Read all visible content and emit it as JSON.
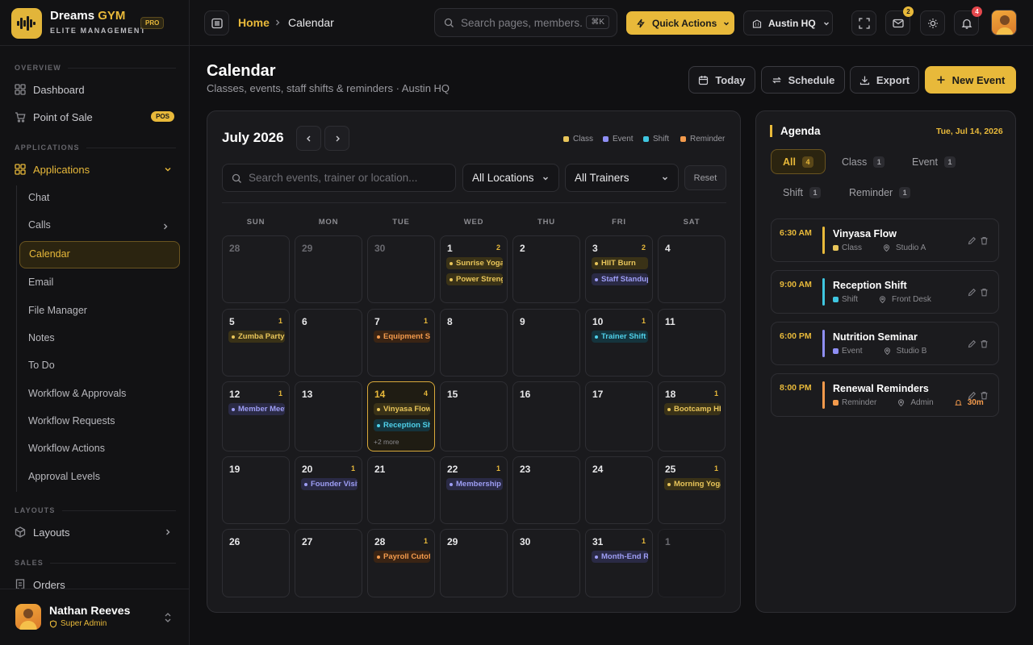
{
  "brand": {
    "name_main": "Dreams",
    "name_accent": "GYM",
    "subtitle": "ELITE MANAGEMENT",
    "badge": "PRO"
  },
  "sidebar": {
    "sections": {
      "overview": "OVERVIEW",
      "applications": "APPLICATIONS",
      "layouts": "LAYOUTS",
      "sales": "SALES"
    },
    "items": [
      {
        "label": "Dashboard",
        "icon": "dashboard-icon"
      },
      {
        "label": "Point of Sale",
        "icon": "cart-icon",
        "badge": "POS"
      },
      {
        "label": "Applications",
        "icon": "apps-grid-icon"
      },
      {
        "label": "Layouts",
        "icon": "cube-icon"
      },
      {
        "label": "Orders",
        "icon": "receipt-icon"
      }
    ],
    "subitems": [
      "Chat",
      "Calls",
      "Calendar",
      "Email",
      "File Manager",
      "Notes",
      "To Do",
      "Workflow & Approvals",
      "Workflow Requests",
      "Workflow Actions",
      "Approval Levels"
    ],
    "user": {
      "name": "Nathan Reeves",
      "role": "Super Admin"
    }
  },
  "topbar": {
    "breadcrumb": {
      "home": "Home",
      "current": "Calendar"
    },
    "search": {
      "placeholder": "Search pages, members...",
      "shortcut": "⌘K"
    },
    "quick_actions": "Quick Actions",
    "location": "Austin HQ",
    "mail_count": "2",
    "notif_count": "4"
  },
  "page": {
    "title": "Calendar",
    "subtitle": "Classes, events, staff shifts & reminders · Austin HQ",
    "buttons": {
      "today": "Today",
      "schedule": "Schedule",
      "export": "Export",
      "new_event": "New Event"
    }
  },
  "calendar": {
    "month": "July 2026",
    "legend": [
      {
        "label": "Class",
        "color": "#e8c55a"
      },
      {
        "label": "Event",
        "color": "#8f8ff5"
      },
      {
        "label": "Shift",
        "color": "#3fc6e0"
      },
      {
        "label": "Reminder",
        "color": "#f39a4c"
      }
    ],
    "filters": {
      "search_placeholder": "Search events, trainer or location...",
      "location": "All Locations",
      "trainer": "All Trainers",
      "reset": "Reset"
    },
    "weekdays": [
      "SUN",
      "MON",
      "TUE",
      "WED",
      "THU",
      "FRI",
      "SAT"
    ],
    "days": [
      {
        "d": "28",
        "muted": true
      },
      {
        "d": "29",
        "muted": true
      },
      {
        "d": "30",
        "muted": true
      },
      {
        "d": "1",
        "count": "2",
        "events": [
          {
            "t": "Sunrise Yoga",
            "k": "class"
          },
          {
            "t": "Power Strength",
            "k": "class"
          }
        ]
      },
      {
        "d": "2"
      },
      {
        "d": "3",
        "count": "2",
        "events": [
          {
            "t": "HIIT Burn",
            "k": "class"
          },
          {
            "t": "Staff Standup",
            "k": "event"
          }
        ]
      },
      {
        "d": "4"
      },
      {
        "d": "5",
        "count": "1",
        "events": [
          {
            "t": "Zumba Party",
            "k": "class"
          }
        ]
      },
      {
        "d": "6"
      },
      {
        "d": "7",
        "count": "1",
        "events": [
          {
            "t": "Equipment Service",
            "k": "reminder"
          }
        ]
      },
      {
        "d": "8"
      },
      {
        "d": "9"
      },
      {
        "d": "10",
        "count": "1",
        "events": [
          {
            "t": "Trainer Shift A",
            "k": "shift"
          }
        ]
      },
      {
        "d": "11"
      },
      {
        "d": "12",
        "count": "1",
        "events": [
          {
            "t": "Member Meetup",
            "k": "event"
          }
        ]
      },
      {
        "d": "13"
      },
      {
        "d": "14",
        "count": "4",
        "today": true,
        "events": [
          {
            "t": "Vinyasa Flow",
            "k": "class"
          },
          {
            "t": "Reception Shift",
            "k": "shift"
          }
        ],
        "more": "+2 more"
      },
      {
        "d": "15"
      },
      {
        "d": "16"
      },
      {
        "d": "17"
      },
      {
        "d": "18",
        "count": "1",
        "events": [
          {
            "t": "Bootcamp HIIT",
            "k": "class"
          }
        ]
      },
      {
        "d": "19"
      },
      {
        "d": "20",
        "count": "1",
        "events": [
          {
            "t": "Founder Visit",
            "k": "event"
          }
        ]
      },
      {
        "d": "21"
      },
      {
        "d": "22",
        "count": "1",
        "events": [
          {
            "t": "Membership Drive",
            "k": "event"
          }
        ]
      },
      {
        "d": "23"
      },
      {
        "d": "24"
      },
      {
        "d": "25",
        "count": "1",
        "events": [
          {
            "t": "Morning Yoga",
            "k": "class"
          }
        ]
      },
      {
        "d": "26"
      },
      {
        "d": "27"
      },
      {
        "d": "28",
        "count": "1",
        "events": [
          {
            "t": "Payroll Cutoff",
            "k": "reminder"
          }
        ]
      },
      {
        "d": "29"
      },
      {
        "d": "30"
      },
      {
        "d": "31",
        "count": "1",
        "events": [
          {
            "t": "Month-End Review",
            "k": "event"
          }
        ]
      },
      {
        "d": "1",
        "muted": true
      }
    ]
  },
  "agenda": {
    "title": "Agenda",
    "date": "Tue, Jul 14, 2026",
    "tabs": [
      {
        "label": "All",
        "count": "4"
      },
      {
        "label": "Class",
        "count": "1"
      },
      {
        "label": "Event",
        "count": "1"
      },
      {
        "label": "Shift",
        "count": "1"
      },
      {
        "label": "Reminder",
        "count": "1"
      }
    ],
    "items": [
      {
        "time": "6:30 AM",
        "name": "Vinyasa Flow",
        "type": "Class",
        "location": "Studio A",
        "color": "#e8b93a",
        "type_color": "#e8c55a"
      },
      {
        "time": "9:00 AM",
        "name": "Reception Shift",
        "type": "Shift",
        "location": "Front Desk",
        "color": "#3fc6e0",
        "type_color": "#3fc6e0"
      },
      {
        "time": "6:00 PM",
        "name": "Nutrition Seminar",
        "type": "Event",
        "location": "Studio B",
        "color": "#8f8ff5",
        "type_color": "#8f8ff5"
      },
      {
        "time": "8:00 PM",
        "name": "Renewal Reminders",
        "type": "Reminder",
        "location": "Admin",
        "color": "#f39a4c",
        "type_color": "#f39a4c",
        "alert": "30m"
      }
    ]
  }
}
